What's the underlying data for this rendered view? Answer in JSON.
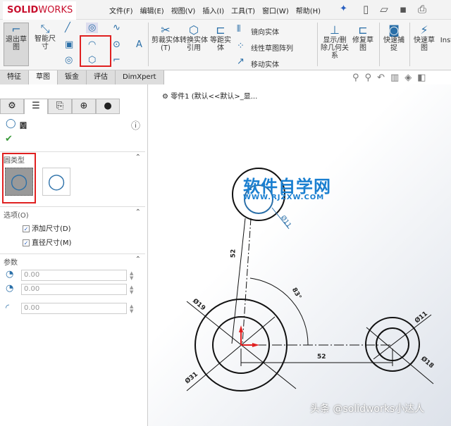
{
  "app": {
    "brand": "SOLID",
    "brand2": "WORKS"
  },
  "menu": [
    "文件(F)",
    "编辑(E)",
    "视图(V)",
    "插入(I)",
    "工具(T)",
    "窗口(W)",
    "帮助(H)"
  ],
  "ribbon": {
    "exit_sketch": "退出草图",
    "smart_dim": "智能尺寸",
    "trim": "剪裁实体(T)",
    "convert": "转换实体引用",
    "offset": "等距实体",
    "mirror": "镜向实体",
    "linear_pattern": "线性草图阵列",
    "move": "移动实体",
    "show_relations": "显示/删除几何关系",
    "repair": "修复草图",
    "quick_snap": "快速捕捉",
    "rapid_sketch": "快速草图",
    "instant": "Inst"
  },
  "tabs": [
    "特征",
    "草图",
    "钣金",
    "评估",
    "DimXpert"
  ],
  "panel": {
    "title": "圆",
    "section_type": "圆类型",
    "section_options": "选项(O)",
    "add_dim": "添加尺寸(D)",
    "diameter_dim": "直径尺寸(M)",
    "section_params": "参数",
    "cx": "0.00",
    "cy": "0.00",
    "radius": "0.00"
  },
  "breadcrumb": "零件1 (默认<<默认>_显...",
  "watermark": {
    "title": "软件自学网",
    "url": "WWW.RJZXW.COM"
  },
  "dims": {
    "d_small_top": "Ø11",
    "len_vertical": "52",
    "angle": "83°",
    "d19": "Ø19",
    "d31": "Ø31",
    "len_horizontal": "52",
    "d11": "Ø11",
    "d18": "Ø18"
  },
  "credit": "头条 @solidworks小达人",
  "colors": {
    "accent": "#2a6fa8",
    "highlight": "#e02020"
  }
}
